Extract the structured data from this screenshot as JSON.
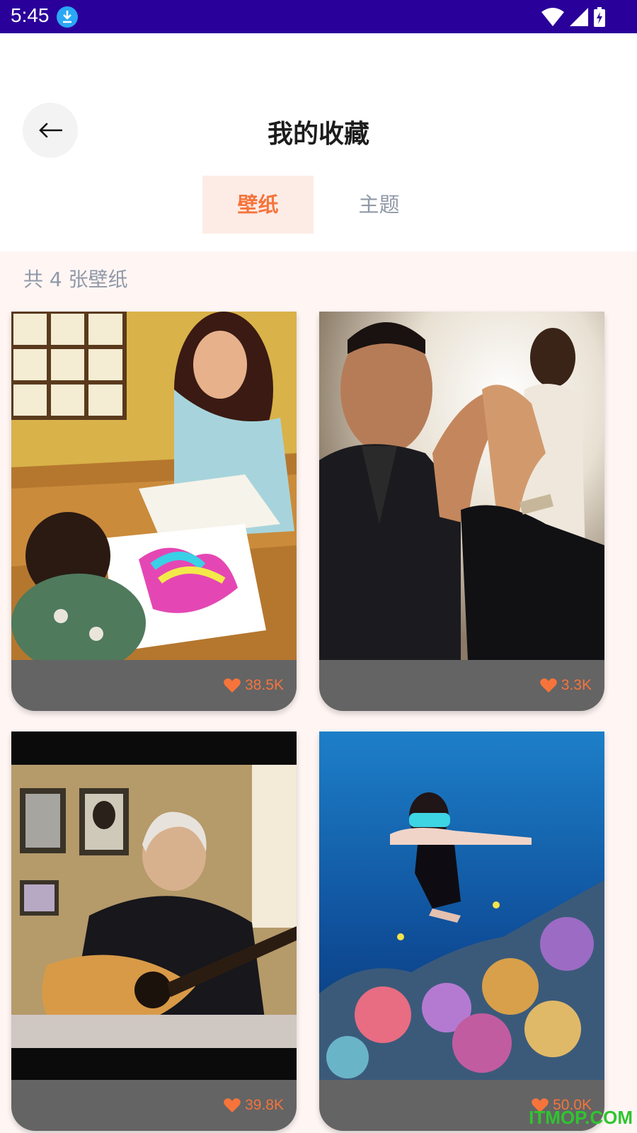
{
  "status_bar": {
    "time": "5:45",
    "download_icon": "download-icon",
    "wifi_icon": "wifi-icon",
    "signal_icon": "signal-icon",
    "battery_icon": "battery-charging-icon"
  },
  "header": {
    "title": "我的收藏",
    "back_icon": "arrow-left-icon"
  },
  "tabs": [
    {
      "label": "壁纸",
      "active": true
    },
    {
      "label": "主题",
      "active": false
    }
  ],
  "content": {
    "count_text": "共 4 张壁纸",
    "wallpapers": [
      {
        "likes": "38.5K",
        "subject": "woman and child drawing at table"
      },
      {
        "likes": "3.3K",
        "subject": "wedding hands raised"
      },
      {
        "likes": "39.8K",
        "subject": "elderly man playing guitar"
      },
      {
        "likes": "50.0K",
        "subject": "diver over coral reef"
      }
    ]
  },
  "watermark": "ITMOP.COM",
  "colors": {
    "status_bar": "#2a009a",
    "accent": "#f6743b",
    "tab_active_bg": "#fdece6",
    "content_bg": "#fff6f4",
    "card_footer": "#646464",
    "muted_text": "#9099a8"
  }
}
